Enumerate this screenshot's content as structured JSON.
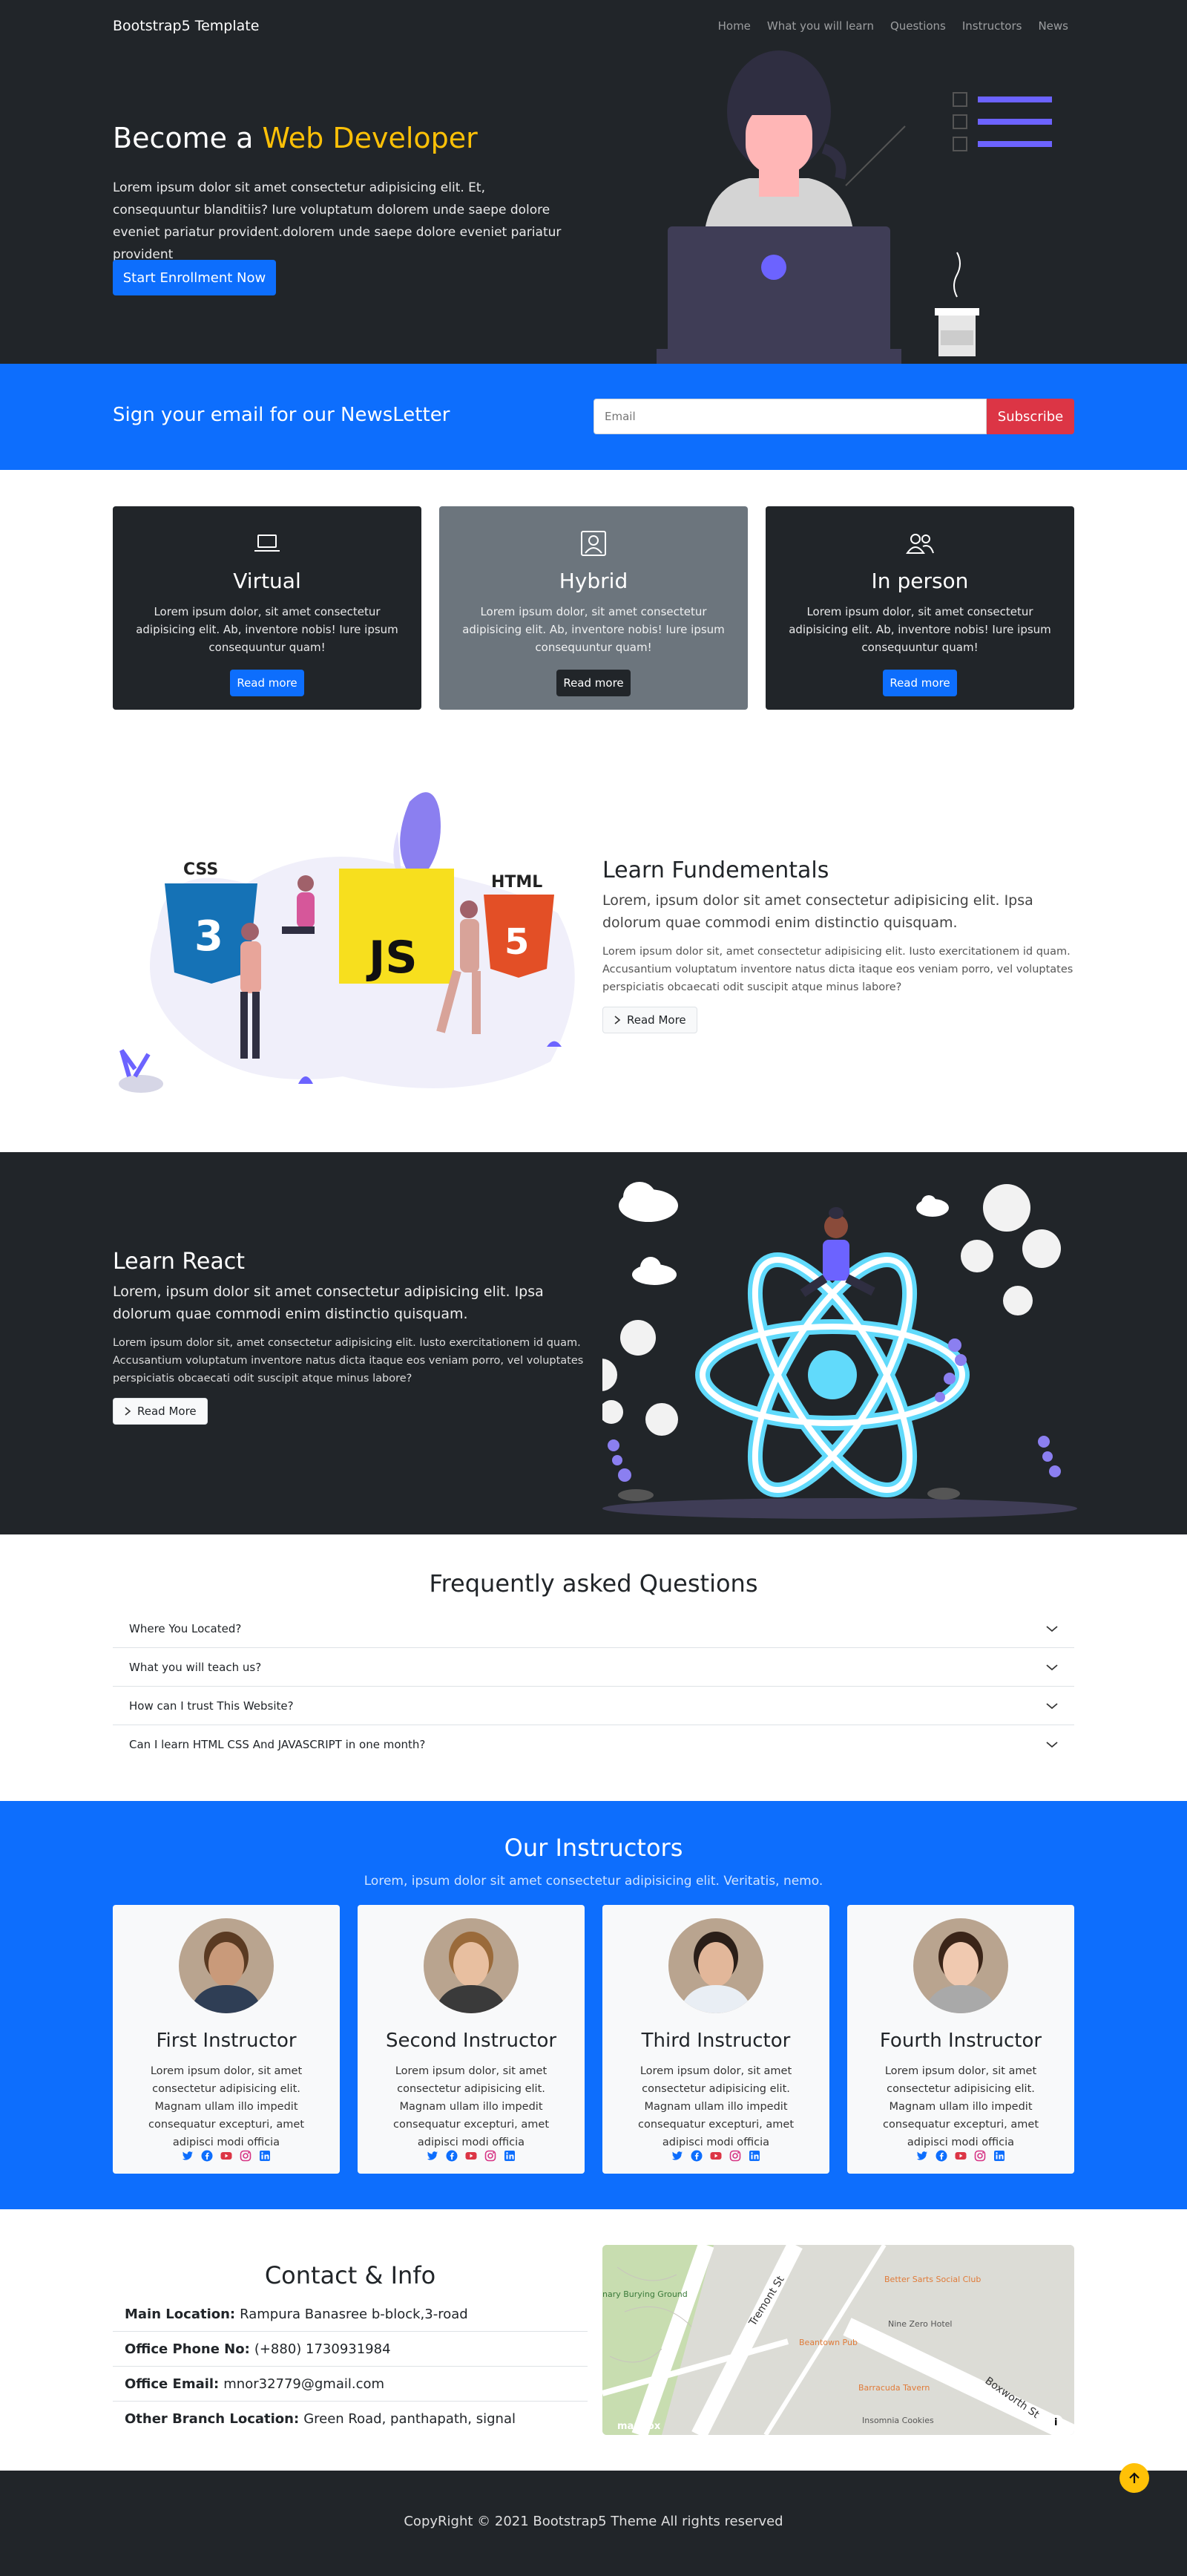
{
  "nav": {
    "brand": "Bootstrap5 Template",
    "links": [
      "Home",
      "What you will learn",
      "Questions",
      "Instructors",
      "News"
    ]
  },
  "hero": {
    "title_prefix": "Become a ",
    "title_accent": "Web Developer",
    "text": "Lorem ipsum dolor sit amet consectetur adipisicing elit. Et, consequuntur blanditiis? Iure voluptatum dolorem unde saepe dolore eveniet pariatur provident.dolorem unde saepe dolore eveniet pariatur provident",
    "button": "Start Enrollment Now",
    "accent_color": "#ffc107"
  },
  "newsletter": {
    "title": "Sign your email for our NewsLetter",
    "placeholder": "Email",
    "button": "Subscribe"
  },
  "cards": [
    {
      "icon": "laptop-icon",
      "title": "Virtual",
      "text": "Lorem ipsum dolor, sit amet consectetur adipisicing elit. Ab, inventore nobis! Iure ipsum consequuntur quam!",
      "button": "Read more",
      "bg": "#212529",
      "btn": "#0d6efd"
    },
    {
      "icon": "person-badge-icon",
      "title": "Hybrid",
      "text": "Lorem ipsum dolor, sit amet consectetur adipisicing elit. Ab, inventore nobis! Iure ipsum consequuntur quam!",
      "button": "Read more",
      "bg": "#6c757d",
      "btn": "#212529"
    },
    {
      "icon": "people-icon",
      "title": "In person",
      "text": "Lorem ipsum dolor, sit amet consectetur adipisicing elit. Ab, inventore nobis! Iure ipsum consequuntur quam!",
      "button": "Read more",
      "bg": "#212529",
      "btn": "#0d6efd"
    }
  ],
  "fundamentals": {
    "title": "Learn Fundementals",
    "lead": "Lorem, ipsum dolor sit amet consectetur adipisicing elit. Ipsa dolorum quae commodi enim distinctio quisquam.",
    "text": "Lorem ipsum dolor sit, amet consectetur adipisicing elit. Iusto exercitationem id quam. Accusantium voluptatum inventore natus dicta itaque eos veniam porro, vel voluptates perspiciatis obcaecati odit suscipit atque minus labore?",
    "button": "Read More",
    "art_labels": {
      "css": "CSS",
      "js": "JS",
      "html": "HTML"
    }
  },
  "react": {
    "title": "Learn React",
    "lead": "Lorem, ipsum dolor sit amet consectetur adipisicing elit. Ipsa dolorum quae commodi enim distinctio quisquam.",
    "text": "Lorem ipsum dolor sit, amet consectetur adipisicing elit. Iusto exercitationem id quam. Accusantium voluptatum inventore natus dicta itaque eos veniam porro, vel voluptates perspiciatis obcaecati odit suscipit atque minus labore?",
    "button": "Read More"
  },
  "faq": {
    "title": "Frequently asked Questions",
    "items": [
      "Where You Located?",
      "What you will teach us?",
      "How can I trust This Website?",
      "Can I learn HTML CSS And JAVASCRIPT in one month?"
    ]
  },
  "instructors": {
    "title": "Our Instructors",
    "subtitle": "Lorem, ipsum dolor sit amet consectetur adipisicing elit. Veritatis, nemo.",
    "people": [
      {
        "name": "First Instructor",
        "text": "Lorem ipsum dolor, sit amet consectetur adipisicing elit. Magnam ullam illo impedit consequatur excepturi, amet adipisci modi officia",
        "hair": "#5a3a22",
        "skin": "#c99a7a",
        "shirt": "#2f3e55"
      },
      {
        "name": "Second Instructor",
        "text": "Lorem ipsum dolor, sit amet consectetur adipisicing elit. Magnam ullam illo impedit consequatur excepturi, amet adipisci modi officia",
        "hair": "#9a6a3a",
        "skin": "#e8bfa0",
        "shirt": "#3a3a3a"
      },
      {
        "name": "Third Instructor",
        "text": "Lorem ipsum dolor, sit amet consectetur adipisicing elit. Magnam ullam illo impedit consequatur excepturi, amet adipisci modi officia",
        "hair": "#2a1e18",
        "skin": "#e2b79a",
        "shirt": "#e9eef4"
      },
      {
        "name": "Fourth Instructor",
        "text": "Lorem ipsum dolor, sit amet consectetur adipisicing elit. Magnam ullam illo impedit consequatur excepturi, amet adipisci modi officia",
        "hair": "#3a2418",
        "skin": "#f0c9b0",
        "shirt": "#a9a9a9"
      }
    ],
    "social_icons": [
      "twitter-icon",
      "facebook-icon",
      "youtube-icon",
      "instagram-icon",
      "linkedin-icon"
    ]
  },
  "contact": {
    "title": "Contact & Info",
    "items": [
      {
        "label": "Main Location:",
        "value": "Rampura Banasree b-block,3-road"
      },
      {
        "label": "Office Phone No:",
        "value": "(+880) 1730931984"
      },
      {
        "label": "Office Email:",
        "value": "mnor32779@gmail.com"
      },
      {
        "label": "Other Branch Location:",
        "value": "Green Road, panthapath, signal"
      }
    ],
    "map_labels": [
      "Tremont St",
      "Boxworth St",
      "Better Sarts Social Club",
      "Nine Zero Hotel",
      "Beantown Pub",
      "Barracuda Tavern",
      "Insomnia Cookies",
      "nary Burying Ground",
      "mapbox"
    ]
  },
  "footer": {
    "text": "CopyRight © 2021 Bootstrap5 Theme All rights reserved"
  }
}
